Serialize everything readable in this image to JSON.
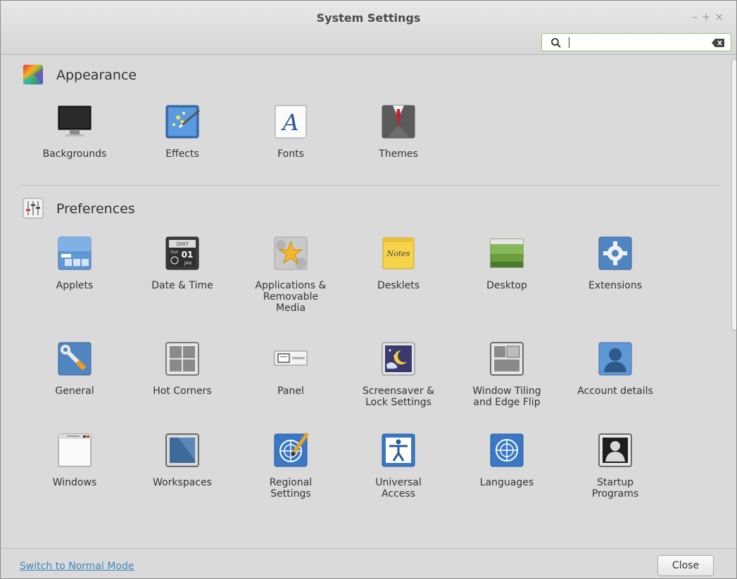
{
  "window": {
    "title": "System Settings",
    "controls": {
      "minimize": "–",
      "maximize": "+",
      "close": "×"
    }
  },
  "search": {
    "value": "",
    "placeholder": ""
  },
  "sections": [
    {
      "title": "Appearance",
      "icon": "appearance-icon",
      "items": [
        {
          "label": "Backgrounds",
          "icon": "backgrounds-icon"
        },
        {
          "label": "Effects",
          "icon": "effects-icon"
        },
        {
          "label": "Fonts",
          "icon": "fonts-icon"
        },
        {
          "label": "Themes",
          "icon": "themes-icon"
        }
      ]
    },
    {
      "title": "Preferences",
      "icon": "preferences-icon",
      "items": [
        {
          "label": "Applets",
          "icon": "applets-icon"
        },
        {
          "label": "Date & Time",
          "icon": "date-time-icon"
        },
        {
          "label": "Applications &\nRemovable\nMedia",
          "icon": "applications-removable-media-icon"
        },
        {
          "label": "Desklets",
          "icon": "desklets-icon"
        },
        {
          "label": "Desktop",
          "icon": "desktop-icon"
        },
        {
          "label": "Extensions",
          "icon": "extensions-icon"
        },
        {
          "label": "General",
          "icon": "general-icon"
        },
        {
          "label": "Hot Corners",
          "icon": "hot-corners-icon"
        },
        {
          "label": "Panel",
          "icon": "panel-icon"
        },
        {
          "label": "Screensaver &\nLock Settings",
          "icon": "screensaver-icon"
        },
        {
          "label": "Window Tiling\nand Edge Flip",
          "icon": "window-tiling-icon"
        },
        {
          "label": "Account details",
          "icon": "account-details-icon"
        },
        {
          "label": "Windows",
          "icon": "windows-icon"
        },
        {
          "label": "Workspaces",
          "icon": "workspaces-icon"
        },
        {
          "label": "Regional\nSettings",
          "icon": "regional-settings-icon"
        },
        {
          "label": "Universal\nAccess",
          "icon": "universal-access-icon"
        },
        {
          "label": "Languages",
          "icon": "languages-icon"
        },
        {
          "label": "Startup\nPrograms",
          "icon": "startup-programs-icon"
        }
      ]
    }
  ],
  "icon_text": {
    "calendar_year": "2007",
    "calendar_weekday": "Sun",
    "calendar_day": "01",
    "calendar_month": "JAN",
    "fonts_letter": "A",
    "notes_text": "Notes"
  },
  "footer": {
    "mode_link": "Switch to Normal Mode",
    "close_label": "Close"
  },
  "colors": {
    "search_border": "#8ec26b",
    "link": "#3a86bf",
    "window_bg": "#dadada"
  }
}
